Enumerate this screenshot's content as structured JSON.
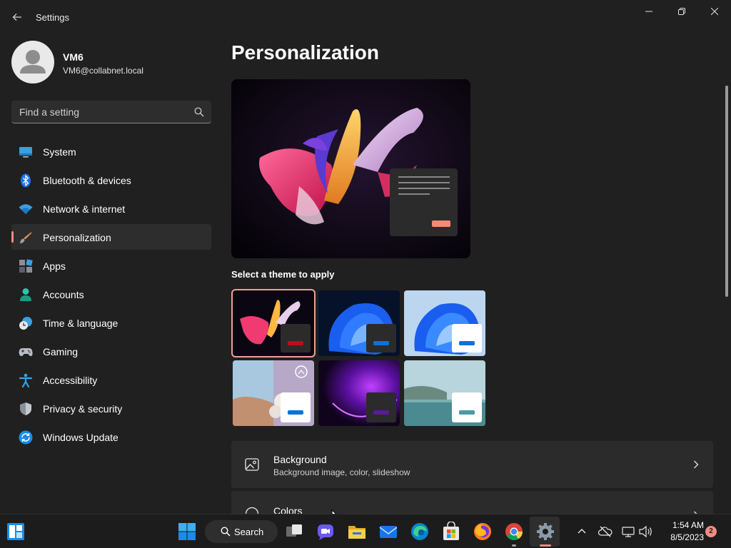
{
  "window": {
    "title": "Settings",
    "back_icon": "back-arrow-icon",
    "controls": [
      "minimize-icon",
      "restore-icon",
      "close-icon"
    ]
  },
  "user": {
    "name": "VM6",
    "email": "VM6@collabnet.local"
  },
  "search": {
    "placeholder": "Find a setting",
    "icon": "search-icon"
  },
  "sidebar": {
    "items": [
      {
        "label": "System",
        "icon": "system-display-icon",
        "active": false
      },
      {
        "label": "Bluetooth & devices",
        "icon": "bluetooth-icon",
        "active": false
      },
      {
        "label": "Network & internet",
        "icon": "wifi-icon",
        "active": false
      },
      {
        "label": "Personalization",
        "icon": "paintbrush-icon",
        "active": true
      },
      {
        "label": "Apps",
        "icon": "apps-icon",
        "active": false
      },
      {
        "label": "Accounts",
        "icon": "person-icon",
        "active": false
      },
      {
        "label": "Time & language",
        "icon": "clock-globe-icon",
        "active": false
      },
      {
        "label": "Gaming",
        "icon": "gamepad-icon",
        "active": false
      },
      {
        "label": "Accessibility",
        "icon": "accessibility-icon",
        "active": false
      },
      {
        "label": "Privacy & security",
        "icon": "shield-icon",
        "active": false
      },
      {
        "label": "Windows Update",
        "icon": "windows-update-icon",
        "active": false
      }
    ],
    "accent_color": "#f28b82"
  },
  "main": {
    "title": "Personalization",
    "theme_section_label": "Select a theme to apply",
    "themes": [
      {
        "id": "glow-dark",
        "selected": true,
        "accent": "#c40a1e"
      },
      {
        "id": "bloom-dark",
        "selected": false,
        "accent": "#0a73d9"
      },
      {
        "id": "bloom-light",
        "selected": false,
        "accent": "#0a73d9"
      },
      {
        "id": "captured-motion",
        "selected": false,
        "accent": "#0a73d9"
      },
      {
        "id": "flow-dark",
        "selected": false,
        "accent": "#5a1a9a"
      },
      {
        "id": "sunrise-light",
        "selected": false,
        "accent": "#4a9aa8"
      }
    ],
    "cards": [
      {
        "title": "Background",
        "subtitle": "Background image, color, slideshow",
        "icon": "image-icon"
      },
      {
        "title": "Colors",
        "subtitle": "",
        "icon": "palette-icon"
      }
    ]
  },
  "taskbar": {
    "search_label": "Search",
    "apps": [
      "start-icon",
      "task-view-icon",
      "teams-chat-icon",
      "file-explorer-icon",
      "mail-icon",
      "edge-icon",
      "store-icon",
      "firefox-icon",
      "chrome-icon",
      "settings-icon"
    ],
    "tray": {
      "time": "1:54 AM",
      "date": "8/5/2023",
      "notification_count": "2"
    }
  }
}
